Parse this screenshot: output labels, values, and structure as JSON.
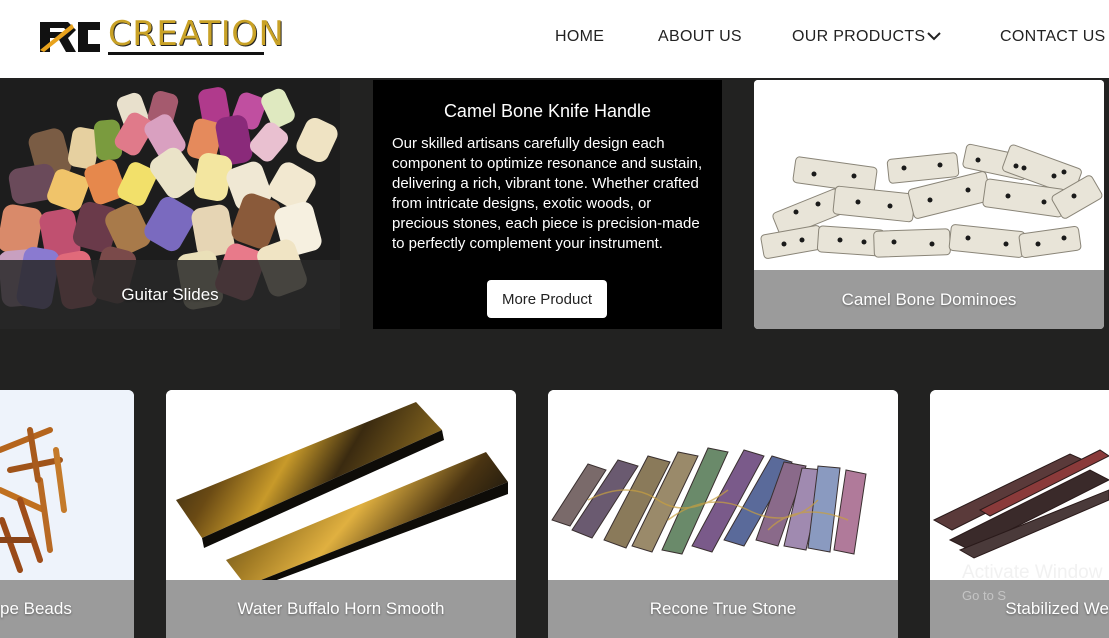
{
  "header": {
    "logo_text": "CREATION",
    "logo_mark": "RC",
    "nav": [
      {
        "label": "HOME"
      },
      {
        "label": "ABOUT US"
      },
      {
        "label": "OUR PRODUCTS"
      },
      {
        "label": "CONTACT US"
      }
    ]
  },
  "row1": {
    "guitar_slides": "Guitar Slides",
    "feature": {
      "title": "Camel Bone Knife Handle",
      "description": "Our skilled artisans carefully design each component to optimize resonance and sustain, delivering a rich, vibrant tone. Whether crafted from intricate designs, exotic woods, or precious stones, each piece is precision-made to perfectly complement your instrument.",
      "button": "More Product"
    },
    "dominoes": "Camel Bone Dominoes"
  },
  "row2": [
    {
      "label": "pe Beads"
    },
    {
      "label": "Water Buffalo Horn Smooth"
    },
    {
      "label": "Recone True Stone"
    },
    {
      "label": "Stabilized We"
    }
  ],
  "watermark": {
    "title": "Activate Window",
    "sub": "Go to S"
  },
  "colors": {
    "background": "#222221",
    "logo_gold": "#c9a227",
    "header_bg": "#ffffff"
  }
}
